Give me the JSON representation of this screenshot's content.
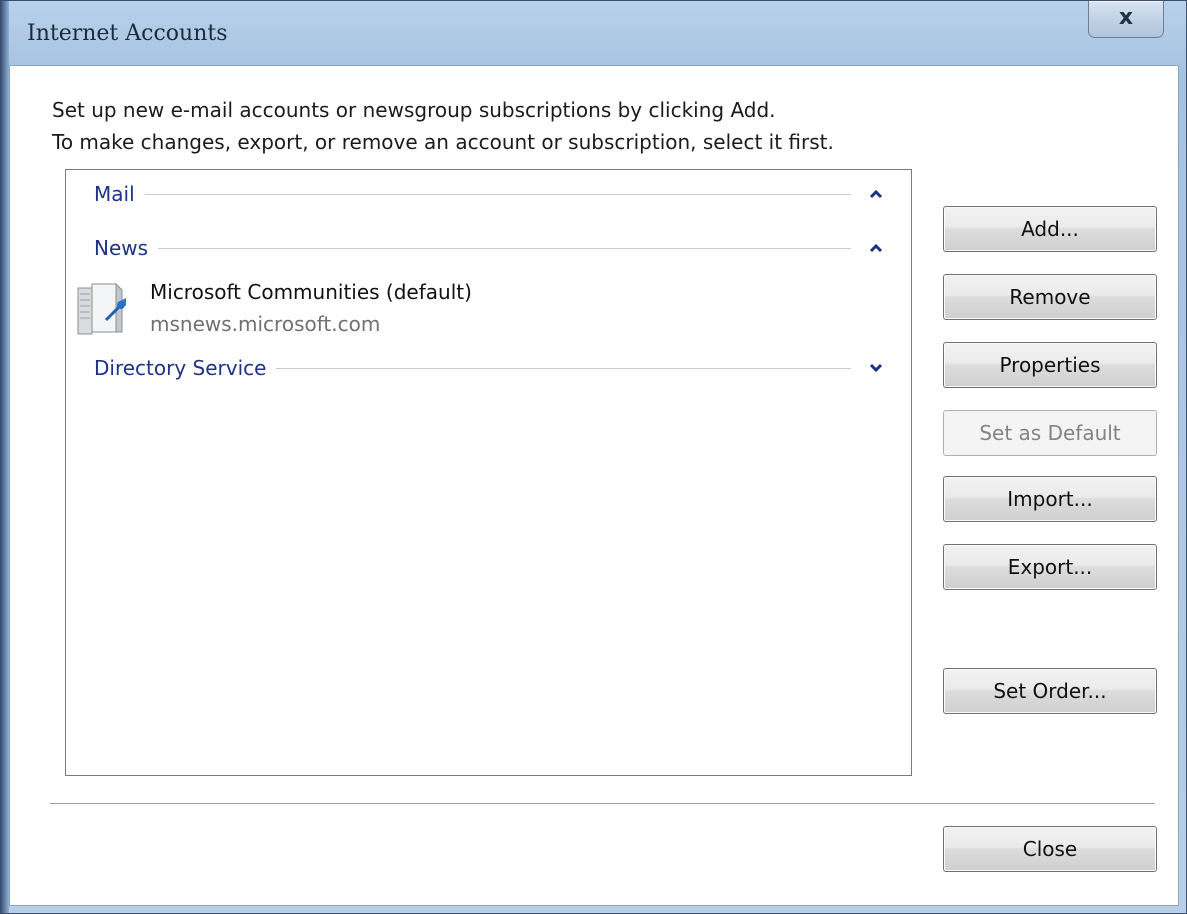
{
  "window": {
    "title": "Internet Accounts",
    "close_glyph": "x"
  },
  "instructions": {
    "line1": "Set up new e-mail accounts or newsgroup subscriptions by clicking Add.",
    "line2": "To make changes, export, or remove an account or subscription, select it first."
  },
  "list": {
    "groups": [
      {
        "label": "Mail",
        "state": "expanded",
        "icon": "chevron-up-icon"
      },
      {
        "label": "News",
        "state": "expanded",
        "icon": "chevron-up-icon"
      },
      {
        "label": "Directory Service",
        "state": "collapsed",
        "icon": "chevron-down-icon"
      }
    ],
    "accounts": [
      {
        "name": "Microsoft Communities (default)",
        "server": "msnews.microsoft.com",
        "icon": "news-server-icon"
      }
    ]
  },
  "buttons": {
    "add": "Add...",
    "remove": "Remove",
    "properties": "Properties",
    "set_default": "Set as Default",
    "import": "Import...",
    "export": "Export...",
    "set_order": "Set Order...",
    "close": "Close"
  },
  "colors": {
    "group_header": "#1e3287",
    "server_text": "#707070",
    "frame": "#a6c2e2"
  }
}
